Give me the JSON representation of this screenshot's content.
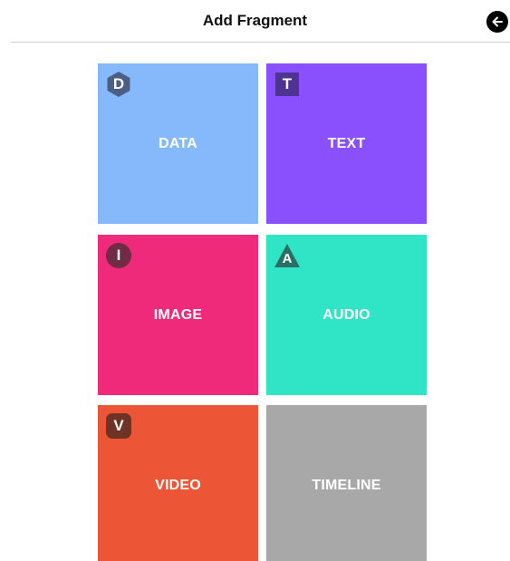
{
  "header": {
    "title": "Add Fragment",
    "back_icon": "arrow-left-circle-icon"
  },
  "tiles": [
    {
      "label": "DATA",
      "badge": "D",
      "color": "#85b9fb",
      "badge_color": "#4b5f86",
      "badge_shape": "hexagon"
    },
    {
      "label": "TEXT",
      "badge": "T",
      "color": "#8a50fd",
      "badge_color": "#4d3392",
      "badge_shape": "square"
    },
    {
      "label": "IMAGE",
      "badge": "I",
      "color": "#ef2a7a",
      "badge_color": "#722b45",
      "badge_shape": "circle"
    },
    {
      "label": "AUDIO",
      "badge": "A",
      "color": "#30e5c5",
      "badge_color": "#2b6f62",
      "badge_shape": "triangle"
    },
    {
      "label": "VIDEO",
      "badge": "V",
      "color": "#ec5636",
      "badge_color": "#6f3326",
      "badge_shape": "rounded-square"
    },
    {
      "label": "TIMELINE",
      "badge": "",
      "color": "#a8a8a8",
      "badge_color": "",
      "badge_shape": "none"
    }
  ]
}
